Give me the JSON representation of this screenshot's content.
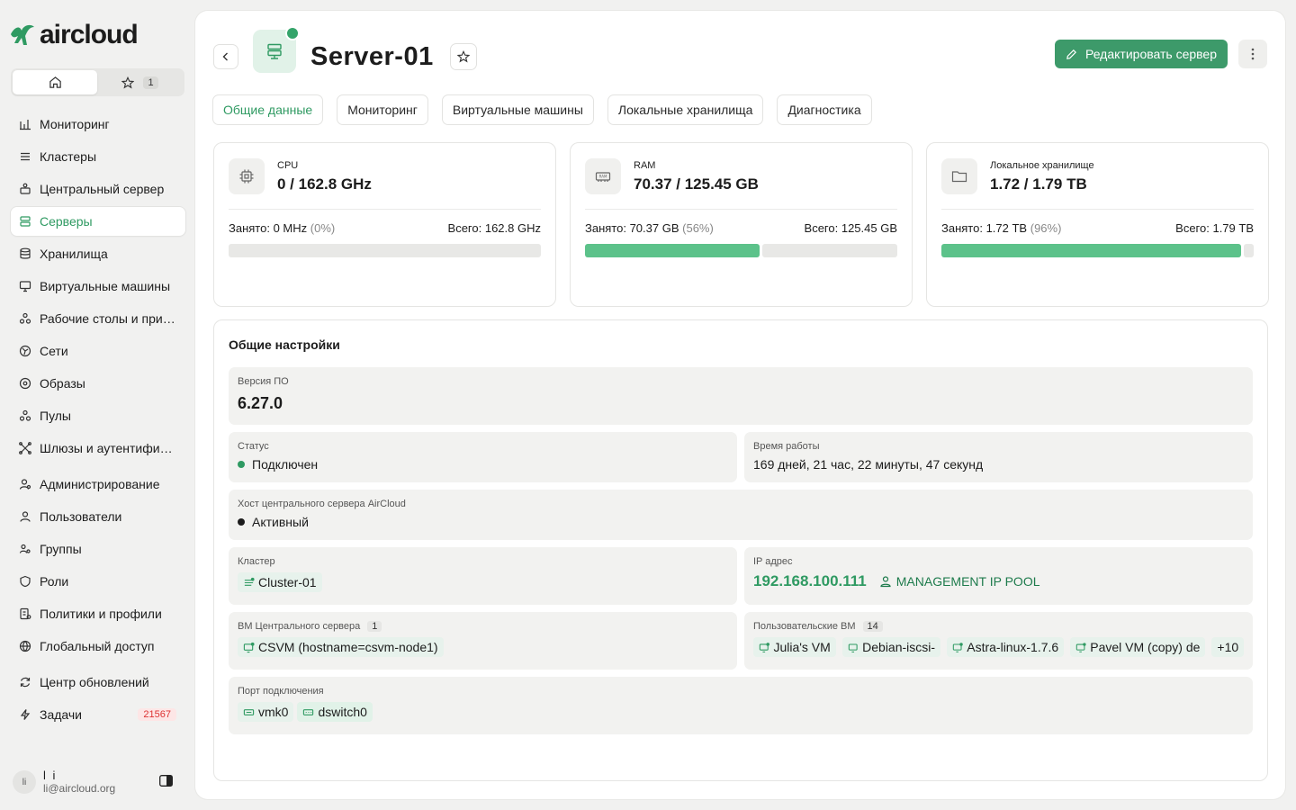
{
  "app": {
    "logo_text": "aircloud"
  },
  "quick": {
    "fav_count": "1"
  },
  "nav": {
    "items": [
      {
        "label": "Мониторинг",
        "icon": "chart-icon"
      },
      {
        "label": "Кластеры",
        "icon": "cluster-icon"
      },
      {
        "label": "Центральный сервер",
        "icon": "central-server-icon"
      },
      {
        "label": "Серверы",
        "icon": "server-icon"
      },
      {
        "label": "Хранилища",
        "icon": "database-icon"
      },
      {
        "label": "Виртуальные машины",
        "icon": "monitor-icon"
      },
      {
        "label": "Рабочие столы и прил...",
        "icon": "desktop-apps-icon"
      },
      {
        "label": "Сети",
        "icon": "network-icon"
      },
      {
        "label": "Образы",
        "icon": "disc-icon"
      },
      {
        "label": "Пулы",
        "icon": "pools-icon"
      },
      {
        "label": "Шлюзы и аутентифика...",
        "icon": "gateway-icon"
      },
      {
        "label": "Администрирование",
        "icon": "admin-icon"
      },
      {
        "label": "Пользователи",
        "icon": "user-icon"
      },
      {
        "label": "Группы",
        "icon": "group-icon"
      },
      {
        "label": "Роли",
        "icon": "shield-icon"
      },
      {
        "label": "Политики и профили",
        "icon": "policy-icon"
      },
      {
        "label": "Глобальный доступ",
        "icon": "globe-icon"
      },
      {
        "label": "Центр обновлений",
        "icon": "refresh-icon"
      },
      {
        "label": "Задачи",
        "icon": "bolt-icon",
        "badge": "21567"
      }
    ]
  },
  "user": {
    "avatar": "li",
    "name": "l i",
    "email": "li@aircloud.org"
  },
  "header": {
    "title": "Server-01",
    "edit_label": "Редактировать сервер"
  },
  "tabs": [
    "Общие данные",
    "Мониторинг",
    "Виртуальные машины",
    "Локальные хранилища",
    "Диагностика"
  ],
  "cards": [
    {
      "label": "CPU",
      "value": "0 / 162.8 GHz",
      "used_label": "Занято:",
      "used": "0 MHz",
      "pct": "(0%)",
      "total": "Всего: 162.8 GHz",
      "fill": 0,
      "icon": "cpu-icon"
    },
    {
      "label": "RAM",
      "value": "70.37 / 125.45 GB",
      "used_label": "Занято:",
      "used": "70.37 GB",
      "pct": "(56%)",
      "total": "Всего: 125.45 GB",
      "fill": 56,
      "icon": "ram-icon"
    },
    {
      "label": "Локальное хранилище",
      "value": "1.72 / 1.79 TB",
      "used_label": "Занято:",
      "used": "1.72 TB",
      "pct": "(96%)",
      "total": "Всего: 1.79 TB",
      "fill": 96,
      "icon": "folder-icon"
    }
  ],
  "settings": {
    "title": "Общие настройки",
    "version_label": "Версия ПО",
    "version": "6.27.0",
    "status_label": "Статус",
    "status": "Подключен",
    "uptime_label": "Время работы",
    "uptime": "169 дней, 21 час, 22 минуты, 47 секунд",
    "host_label": "Хост центрального сервера AirCloud",
    "host": "Активный",
    "cluster_label": "Кластер",
    "cluster": "Cluster-01",
    "ip_label": "IP адрес",
    "ip": "192.168.100.111",
    "ip_pool": "MANAGEMENT IP POOL",
    "csvm_label": "ВМ Центрального сервера",
    "csvm_count": "1",
    "csvm": "CSVM (hostname=csvm-node1)",
    "uservm_label": "Пользовательские ВМ",
    "uservm_count": "14",
    "uservms": [
      "Julia's VM",
      "Debian-iscsi-",
      "Astra-linux-1.7.6",
      "Pavel VM (copy) de"
    ],
    "uservm_more": "+10",
    "port_label": "Порт подключения",
    "port_nic": "vmk0",
    "port_switch": "dswitch0"
  },
  "colors": {
    "accent": "#3d9a6a",
    "accent_light": "#e1f2e8",
    "bar": "#5cc28a",
    "badge_red": "#d33"
  }
}
